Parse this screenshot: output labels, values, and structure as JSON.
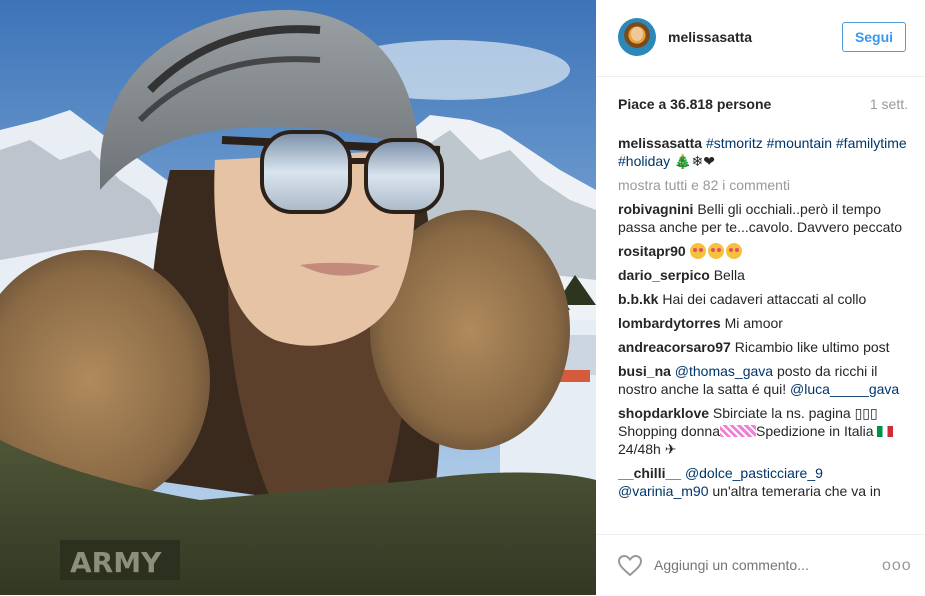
{
  "post": {
    "username": "melissasatta",
    "follow_label": "Segui",
    "likes": "Piace a 36.818 persone",
    "time": "1 sett."
  },
  "caption": {
    "username": "melissasatta",
    "text": "#stmoritz #mountain #familytime #holiday",
    "emoji": " 🎄❄❤"
  },
  "more_comments": "mostra tutti e 82 i commenti",
  "comments": [
    {
      "user": "robivagnini",
      "text": "Belli gli occhiali..però il tempo passa anche per te...cavolo. Davvero peccato"
    },
    {
      "user": "rositapr90",
      "text": ""
    },
    {
      "user": "dario_serpico",
      "text": "Bella"
    },
    {
      "user": "b.b.kk",
      "text": "Hai dei cadaveri attaccati al collo"
    },
    {
      "user": "lombardytorres",
      "text": "Mi amoor"
    },
    {
      "user": "andreacorsaro97",
      "text": "Ricambio like ultimo post"
    },
    {
      "user": "busi_na",
      "mention1": "@thomas_gava",
      "text": "posto da ricchi il nostro anche la satta é qui!",
      "mention2": "@luca_____gava"
    },
    {
      "user": "shopdarklove",
      "text1": "Sbirciate la ns. pagina ▯▯▯ Shopping donna",
      "text2": "Spedizione in Italia",
      "text3": "24/48h ✈"
    },
    {
      "user": "__chilli__",
      "mention1": "@dolce_pasticciare_9",
      "mention2": "@varinia_m90",
      "text": "un'altra temeraria che va in"
    }
  ],
  "add_comment_placeholder": "Aggiungi un commento...",
  "options_label": "ooo",
  "icons": {
    "like": "heart-icon",
    "options": "more-options-icon"
  },
  "colors": {
    "link": "#003569",
    "follow": "#3897f0",
    "muted": "#999999"
  }
}
